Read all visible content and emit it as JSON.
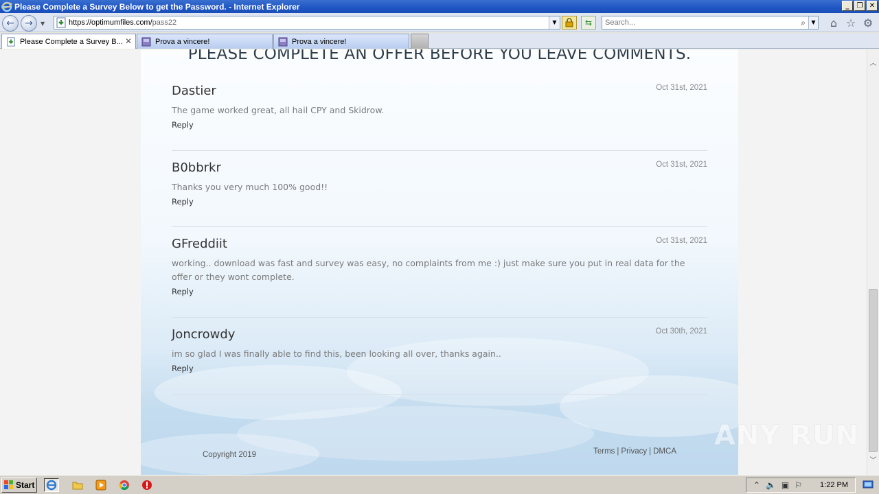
{
  "window": {
    "title": "Please Complete a Survey Below to get the Password. - Internet Explorer",
    "controls": [
      "minimize",
      "restore",
      "close"
    ]
  },
  "addressbar": {
    "url_host": "https://optimumfiles.com/",
    "url_path": "pass22",
    "search_placeholder": "Search..."
  },
  "tabs": [
    {
      "label": "Please Complete a Survey B...",
      "active": true
    },
    {
      "label": "Prova a vincere!",
      "active": false
    },
    {
      "label": "Prova a vincere!",
      "active": false
    }
  ],
  "page": {
    "heading": "PLEASE COMPLETE AN OFFER BEFORE YOU LEAVE COMMENTS.",
    "comments": [
      {
        "name": "Dastier",
        "date": "Oct 31st, 2021",
        "text": "The game worked great, all hail CPY and Skidrow.",
        "reply": "Reply"
      },
      {
        "name": "B0bbrkr",
        "date": "Oct 31st, 2021",
        "text": "Thanks you very much 100% good!!",
        "reply": "Reply"
      },
      {
        "name": "GFreddiit",
        "date": "Oct 31st, 2021",
        "text": "working.. download was fast and survey was easy, no complaints from me :) just make sure you put in real data for the offer or they wont complete.",
        "reply": "Reply"
      },
      {
        "name": "Joncrowdy",
        "date": "Oct 30th, 2021",
        "text": "im so glad I was finally able to find this, been looking all over, thanks again..",
        "reply": "Reply"
      }
    ],
    "footer": {
      "copyright": "Copyright 2019",
      "links": [
        "Terms",
        "Privacy",
        "DMCA"
      ],
      "separator": "|"
    }
  },
  "watermark": {
    "text": "ANY RUN"
  },
  "taskbar": {
    "start_label": "Start",
    "clock": "1:22 PM",
    "quick_launch": [
      "ie-icon",
      "folder-icon",
      "media-player-icon",
      "chrome-icon",
      "stop-icon"
    ]
  },
  "colors": {
    "titlebar": "#1f55c4",
    "heading": "#2f3d4a",
    "comment_text": "#7a7a7a",
    "date": "#8a8a8a"
  }
}
